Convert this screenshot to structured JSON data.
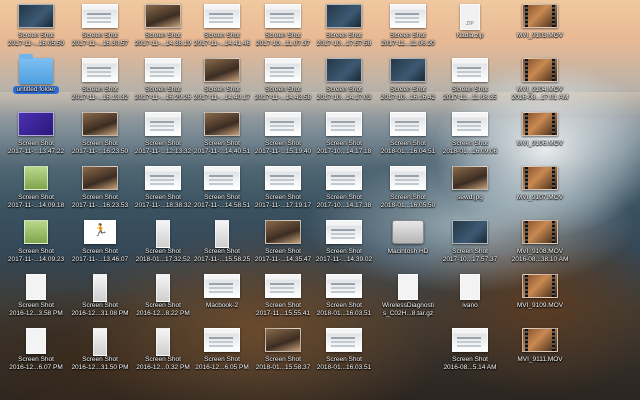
{
  "desktop": {
    "icons": [
      {
        "id": "c1r1",
        "type": "dark",
        "name": "Screen Shot",
        "date": "2017-11-...16.05.50"
      },
      {
        "id": "c2r1",
        "type": "light",
        "name": "Screen Shot",
        "date": "2017-11-...16.30.57"
      },
      {
        "id": "c3r1",
        "type": "photo",
        "name": "Screen Shot",
        "date": "2017-11-...14.38.19"
      },
      {
        "id": "c4r1",
        "type": "light",
        "name": "Screen Shot",
        "date": "2017-11-...14.41.46"
      },
      {
        "id": "c5r1",
        "type": "light",
        "name": "Screen Shot",
        "date": "2017-10...11.07.37"
      },
      {
        "id": "c6r1",
        "type": "dark",
        "name": "Screen Shot",
        "date": "2017-10...17.57.58"
      },
      {
        "id": "c7r1",
        "type": "light",
        "name": "Screen Shot",
        "date": "2017-11...11.06.20"
      },
      {
        "id": "c8r1",
        "type": "zip",
        "name": "Nadia.zip",
        "date": ""
      },
      {
        "id": "c9r1",
        "type": "mov",
        "name": "MVI_9103.MOV",
        "date": ""
      },
      {
        "id": "c1r2",
        "type": "folder",
        "name": "untitled folder",
        "date": "",
        "selected": true
      },
      {
        "id": "c2r2",
        "type": "light",
        "name": "Screen Shot",
        "date": "2017-11-...16.13.32"
      },
      {
        "id": "c3r2",
        "type": "light",
        "name": "Screen Shot",
        "date": "2017-11-...16.29.26"
      },
      {
        "id": "c4r2",
        "type": "photo",
        "name": "Screen Shot",
        "date": "2017-11-...14.40.17"
      },
      {
        "id": "c5r2",
        "type": "light",
        "name": "Screen Shot",
        "date": "2017-11-...14.43.58"
      },
      {
        "id": "c6r2",
        "type": "dark",
        "name": "Screen Shot",
        "date": "2017-10...14.17.03"
      },
      {
        "id": "c7r2",
        "type": "dark",
        "name": "Screen Shot",
        "date": "2017-10...16.16.42"
      },
      {
        "id": "c8r2",
        "type": "light",
        "name": "Screen Shot",
        "date": "2017-11...11.08.35"
      },
      {
        "id": "c9r2",
        "type": "mov",
        "name": "MVI_9104.MOV",
        "date": "2016-08...17.01 AM"
      },
      {
        "id": "c1r3",
        "type": "horse",
        "name": "Screen Shot",
        "date": "2017-11-...13.47.22"
      },
      {
        "id": "c2r3",
        "type": "photo",
        "name": "Screen Shot",
        "date": "2017-11-...16.23.50"
      },
      {
        "id": "c3r3",
        "type": "light",
        "name": "Screen Shot",
        "date": "2017-11-...12.13.32"
      },
      {
        "id": "c4r3",
        "type": "photo",
        "name": "Screen Shot",
        "date": "2017-11-...14.40.51"
      },
      {
        "id": "c5r3",
        "type": "light",
        "name": "Screen Shot",
        "date": "2017-11-...15.19.40"
      },
      {
        "id": "c6r3",
        "type": "light",
        "name": "Screen Shot",
        "date": "2017-10...14.17.18"
      },
      {
        "id": "c7r3",
        "type": "light",
        "name": "Screen Shot",
        "date": "2018-01...16.04.51"
      },
      {
        "id": "c8r3",
        "type": "light",
        "name": "Screen Shot",
        "date": "2018-01...16.09.06"
      },
      {
        "id": "c9r3",
        "type": "mov",
        "name": "MVI_9106.MOV",
        "date": ""
      },
      {
        "id": "c1r4",
        "type": "green",
        "name": "Screen Shot",
        "date": "2017-11-...14.09.18"
      },
      {
        "id": "c2r4",
        "type": "photo",
        "name": "Screen Shot",
        "date": "2017-11-...16.23.53"
      },
      {
        "id": "c3r4",
        "type": "light",
        "name": "Screen Shot",
        "date": "2017-11-...18.38.32"
      },
      {
        "id": "c4r4",
        "type": "light",
        "name": "Screen Shot",
        "date": "2017-11-...14.58.51"
      },
      {
        "id": "c5r4",
        "type": "light",
        "name": "Screen Shot",
        "date": "2017-11-...17.19.17"
      },
      {
        "id": "c6r4",
        "type": "light",
        "name": "Screen Shot",
        "date": "2017-10...14.17.38"
      },
      {
        "id": "c7r4",
        "type": "light",
        "name": "Screen Shot",
        "date": "2018-01...16.05.50"
      },
      {
        "id": "c8r4",
        "type": "photo",
        "name": "sewd.jpg",
        "date": ""
      },
      {
        "id": "c9r4",
        "type": "mov",
        "name": "MVI_9107.MOV",
        "date": ""
      },
      {
        "id": "c1r5",
        "type": "green",
        "name": "Screen Shot",
        "date": "2017-11-...14.09.23"
      },
      {
        "id": "c2r5",
        "type": "runner",
        "name": "Screen Shot",
        "date": "2017-11-...13.46.07"
      },
      {
        "id": "c3r5",
        "type": "tall",
        "name": "Screen Shot",
        "date": "2018-01...17.32.52"
      },
      {
        "id": "c4r5",
        "type": "tall",
        "name": "Screen Shot",
        "date": "2017-11-...15.58.25"
      },
      {
        "id": "c5r5",
        "type": "photo",
        "name": "Screen Shot",
        "date": "2017-11-...14.35.47"
      },
      {
        "id": "c6r5",
        "type": "light",
        "name": "Screen Shot",
        "date": "2017-11-...14.39.02"
      },
      {
        "id": "c7r5",
        "type": "drive",
        "name": "Macintosh HD",
        "date": ""
      },
      {
        "id": "c8r5",
        "type": "dark",
        "name": "Screen Shot",
        "date": "2017-10...17.57.37"
      },
      {
        "id": "c9r5",
        "type": "mov",
        "name": "MVI_9108.MOV",
        "date": "2016-08...38.10 AM"
      },
      {
        "id": "c1r6",
        "type": "doc",
        "name": "Screen Shot",
        "date": "2016-12...3.58 PM"
      },
      {
        "id": "c2r6",
        "type": "tall",
        "name": "Screen Shot",
        "date": "2016-12...31.08 PM"
      },
      {
        "id": "c3r6",
        "type": "tall",
        "name": "Screen Shot",
        "date": "2016-12...8.22 PM"
      },
      {
        "id": "c4r6",
        "type": "light",
        "name": "Macbook-2",
        "date": ""
      },
      {
        "id": "c5r6",
        "type": "light",
        "name": "Screen Shot",
        "date": "2017-11...15.55.41"
      },
      {
        "id": "c6r6",
        "type": "light",
        "name": "Screen Shot",
        "date": "2018-01...16.03.51"
      },
      {
        "id": "c7r6",
        "type": "doc",
        "name": "WirelessDiagnosti",
        "date": "s_C02H...8.tar.gz"
      },
      {
        "id": "c8r6",
        "type": "doc",
        "name": "ivano",
        "date": ""
      },
      {
        "id": "c9r6",
        "type": "mov",
        "name": "MVI_9109.MOV",
        "date": ""
      },
      {
        "id": "c1r7",
        "type": "doc",
        "name": "Screen Shot",
        "date": "2016-12...6.07 PM"
      },
      {
        "id": "c2r7",
        "type": "tall",
        "name": "Screen Shot",
        "date": "2016-12...31.50 PM"
      },
      {
        "id": "c3r7",
        "type": "tall",
        "name": "Screen Shot",
        "date": "2016-12...0.32 PM"
      },
      {
        "id": "c4r7",
        "type": "light",
        "name": "Screen Shot",
        "date": "2016-12...6.05 PM"
      },
      {
        "id": "c5r7",
        "type": "photo",
        "name": "Screen Shot",
        "date": "2018-01...15.58.37"
      },
      {
        "id": "c6r7",
        "type": "light",
        "name": "Screen Shot",
        "date": "2018-01...16.03.51"
      },
      {
        "id": "c8r7",
        "type": "light",
        "name": "Screen Shot",
        "date": "2016-08...5.14 AM"
      },
      {
        "id": "c9r7",
        "type": "mov",
        "name": "MVI_9111.MOV",
        "date": ""
      }
    ]
  }
}
